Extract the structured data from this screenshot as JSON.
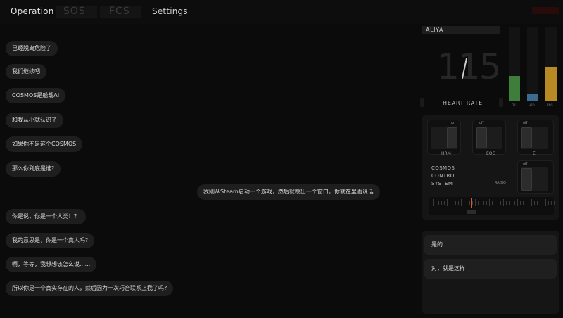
{
  "tabs": [
    {
      "label": "Operation"
    },
    {
      "label": "SOS"
    },
    {
      "label": "FCS"
    },
    {
      "label": "Settings"
    }
  ],
  "chat": {
    "left_messages": [
      "已经脱离危险了",
      "我们继续吧",
      "COSMOS是船载AI",
      "和我从小就认识了",
      "如果你不是这个COSMOS",
      "那么你到底是谁?"
    ],
    "right_message": "我刚从Steam启动一个游戏，然后就跳出一个窗口，你就在里面说话",
    "left_messages_2": [
      "你是说，你是一个人类！？",
      "我的意思是，你是一个真人吗?",
      "啊，等等，我想想该怎么说......",
      "所以你是一个真实存在的人，然后因为一次巧合联系上我了吗?"
    ]
  },
  "status": {
    "name": "ALIYA",
    "heart_rate_label": "HEART RATE",
    "heart_rate_value": "115",
    "bars": [
      {
        "label": "O2",
        "level": 0.34,
        "color": "#3f7d3b"
      },
      {
        "label": "H2O",
        "level": 0.1,
        "color": "#3d6a8f"
      },
      {
        "label": "ENG",
        "level": 0.46,
        "color": "#b88a23"
      }
    ]
  },
  "controls": {
    "switches": [
      {
        "state": "on",
        "label": "HRM"
      },
      {
        "state": "off",
        "label": "EOG"
      },
      {
        "state": "off",
        "label": "EH"
      }
    ],
    "system_lines": [
      "COSMOS",
      "CONTROL",
      "SYSTEM"
    ],
    "radio_label": "RADIO",
    "radio_state": "off"
  },
  "replies": [
    "是的",
    "对，就是这样"
  ]
}
